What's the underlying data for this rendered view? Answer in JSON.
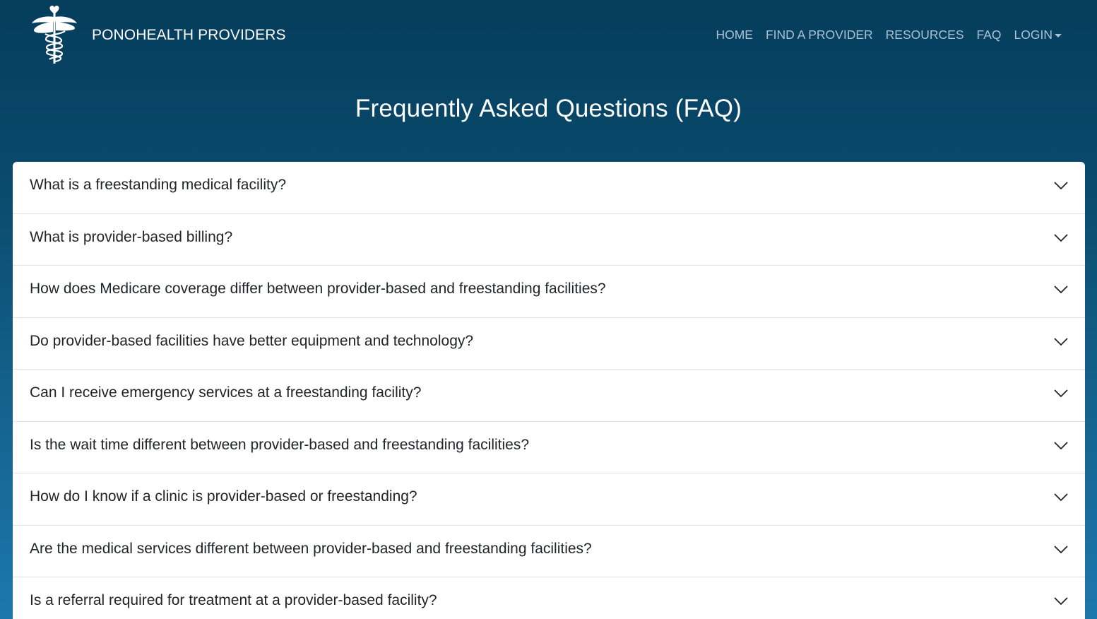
{
  "brand": {
    "name": "PONOHEALTH PROVIDERS",
    "logo_icon": "caduceus-heart-icon"
  },
  "nav": {
    "items": [
      {
        "label": "HOME"
      },
      {
        "label": "FIND A PROVIDER"
      },
      {
        "label": "RESOURCES"
      },
      {
        "label": "FAQ"
      },
      {
        "label": "LOGIN",
        "dropdown": true
      }
    ]
  },
  "page": {
    "title": "Frequently Asked Questions (FAQ)"
  },
  "faq": {
    "items": [
      {
        "question": "What is a freestanding medical facility?"
      },
      {
        "question": "What is provider-based billing?"
      },
      {
        "question": "How does Medicare coverage differ between provider-based and freestanding facilities?"
      },
      {
        "question": "Do provider-based facilities have better equipment and technology?"
      },
      {
        "question": "Can I receive emergency services at a freestanding facility?"
      },
      {
        "question": "Is the wait time different between provider-based and freestanding facilities?"
      },
      {
        "question": "How do I know if a clinic is provider-based or freestanding?"
      },
      {
        "question": "Are the medical services different between provider-based and freestanding facilities?"
      },
      {
        "question": "Is a referral required for treatment at a provider-based facility?"
      }
    ]
  },
  "colors": {
    "header_bg": "#053d5c",
    "gradient_bottom": "#1d77ad",
    "nav_text": "#a9c1d3",
    "card_bg": "#ffffff",
    "question_text": "#212529"
  }
}
